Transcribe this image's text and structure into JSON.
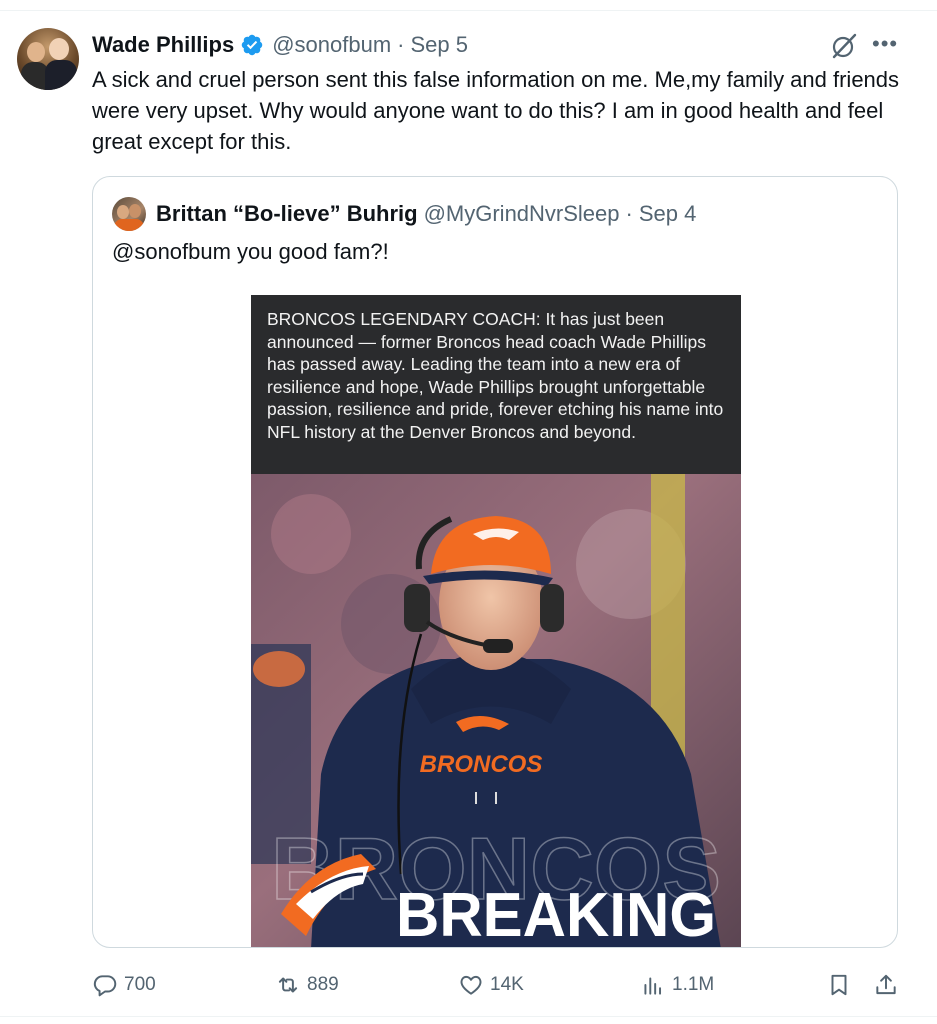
{
  "tweet": {
    "author_name": "Wade Phillips",
    "handle": "@sonofbum",
    "separator": "·",
    "date": "Sep 5",
    "text": "A sick and cruel person sent this false information on me. Me,my family and friends were very upset. Why would anyone want to do this? I am in good health and feel great except for this."
  },
  "quote": {
    "author_name": "Brittan “Bo-lieve” Buhrig",
    "handle": "@MyGrindNvrSleep",
    "separator": "·",
    "date": "Sep 4",
    "text": "@sonofbum you good fam?!",
    "media": {
      "caption": "BRONCOS LEGENDARY COACH: It has just been announced — former Broncos head coach Wade Phillips has passed away. Leading the team into a new era of resilience and hope, Wade Phillips brought unforgettable passion, resilience and pride, forever etching his name into NFL history at the Denver Broncos and beyond.",
      "jersey_text": "BRONCOS",
      "banner_text": "BREAKING",
      "banner_outline_text": "BRONCOS"
    }
  },
  "actions": {
    "replies": "700",
    "retweets": "889",
    "likes": "14K",
    "views": "1.1M"
  },
  "icons": {
    "verified": "verified-badge-icon",
    "grok": "grok-icon",
    "more": "more-icon",
    "reply": "reply-icon",
    "retweet": "retweet-icon",
    "like": "heart-icon",
    "views": "views-chart-icon",
    "bookmark": "bookmark-icon",
    "share": "share-icon"
  },
  "colors": {
    "text": "#0f1419",
    "secondary": "#536471",
    "verified": "#1d9bf0",
    "broncos_orange": "#f26b21",
    "broncos_navy": "#1d2a4d"
  }
}
